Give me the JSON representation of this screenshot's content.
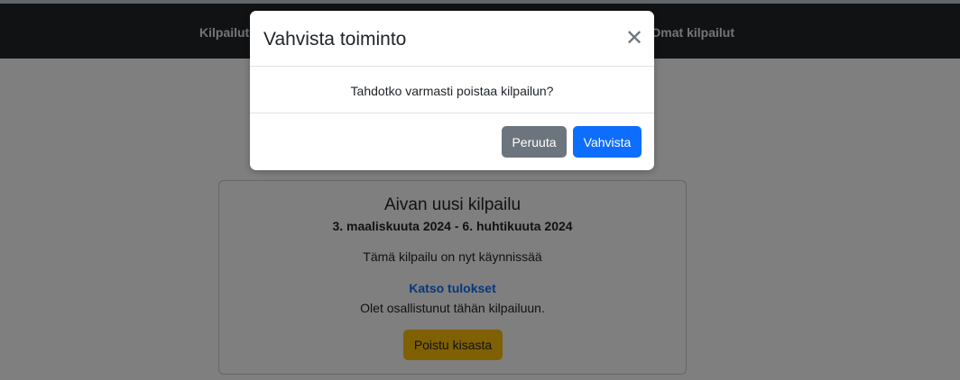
{
  "navbar": {
    "left_link": "Kilpailut",
    "right_link": "Omat kilpailut"
  },
  "card": {
    "title": "Aivan uusi kilpailu",
    "dates": "3. maaliskuuta 2024 - 6. huhtikuuta 2024",
    "status": "Tämä kilpailu on nyt käynnissää",
    "results_link": "Katso tulokset",
    "participated": "Olet osallistunut tähän kilpailuun.",
    "leave_button": "Poistu kisasta"
  },
  "modal": {
    "title": "Vahvista toiminto",
    "close_symbol": "✕",
    "message": "Tahdotko varmasti poistaa kilpailun?",
    "cancel_button": "Peruuta",
    "confirm_button": "Vahvista"
  },
  "colors": {
    "navbar": "#212529",
    "primary": "#0d6efd",
    "secondary": "#6c757d",
    "warning": "#ffc107"
  }
}
